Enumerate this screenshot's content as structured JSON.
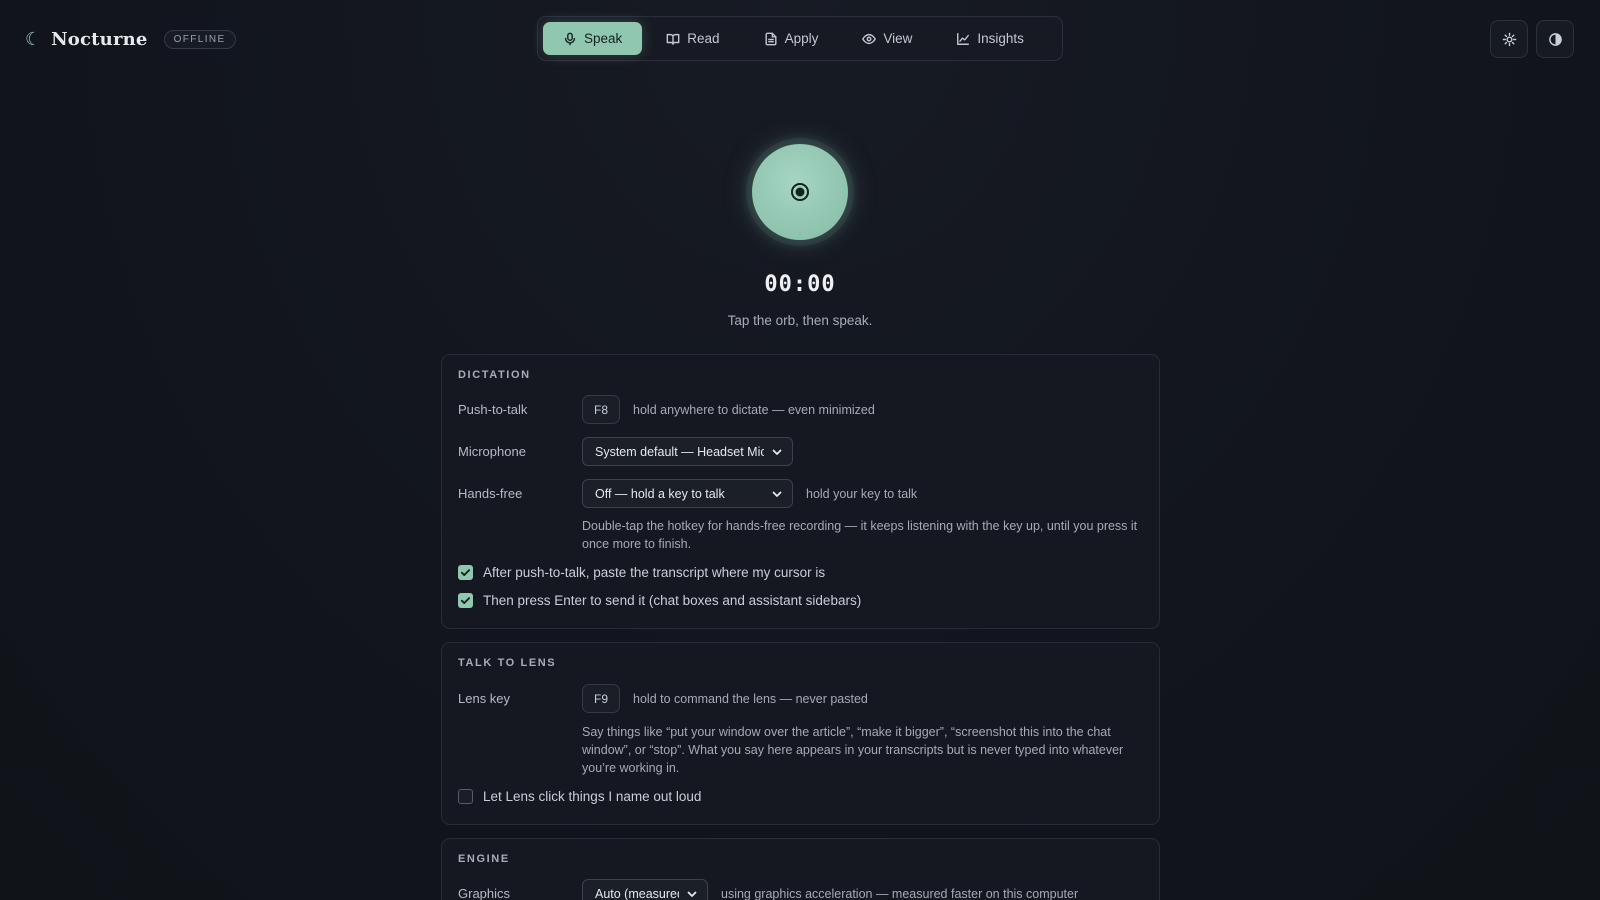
{
  "brand": {
    "name": "Nocturne",
    "status": "OFFLINE"
  },
  "nav": {
    "tabs": [
      {
        "label": "Speak",
        "icon": "mic-icon",
        "active": true
      },
      {
        "label": "Read",
        "icon": "book-icon"
      },
      {
        "label": "Apply",
        "icon": "document-icon"
      },
      {
        "label": "View",
        "icon": "eye-icon"
      },
      {
        "label": "Insights",
        "icon": "chart-icon"
      }
    ]
  },
  "header_icons": [
    "gear-icon",
    "contrast-icon"
  ],
  "recorder": {
    "timer": "00:00",
    "hint": "Tap the orb, then speak."
  },
  "dictation": {
    "title": "DICTATION",
    "ptt_label": "Push-to-talk",
    "ptt_key": "F8",
    "ptt_note": "hold anywhere to dictate — even minimized",
    "mic_label": "Microphone",
    "mic_value": "System default — Headset Microphone",
    "handsfree_label": "Hands-free",
    "handsfree_value": "Off — hold a key to talk",
    "handsfree_note": "hold your key to talk",
    "handsfree_help": "Double-tap the hotkey for hands-free recording — it keeps listening with the key up, until you press it once more to finish.",
    "paste_label": "After push-to-talk, paste the transcript where my cursor is",
    "paste_checked": true,
    "enter_label": "Then press Enter to send it (chat boxes and assistant sidebars)",
    "enter_checked": true
  },
  "lens": {
    "title": "TALK TO LENS",
    "key_label": "Lens key",
    "key": "F9",
    "key_note": "hold to command the lens — never pasted",
    "help": "Say things like “put your window over the article”, “make it bigger”, “screenshot this into the chat window”, or “stop”. What you say here appears in your transcripts but is never typed into whatever you’re working in.",
    "click_label": "Let Lens click things I name out loud",
    "click_checked": false
  },
  "engine": {
    "title": "ENGINE",
    "graphics_label": "Graphics",
    "graphics_value": "Auto (measured)",
    "graphics_note": "using graphics acceleration — measured faster on this computer"
  },
  "colors": {
    "accent": "#8fc7b1",
    "background": "#12151d"
  }
}
